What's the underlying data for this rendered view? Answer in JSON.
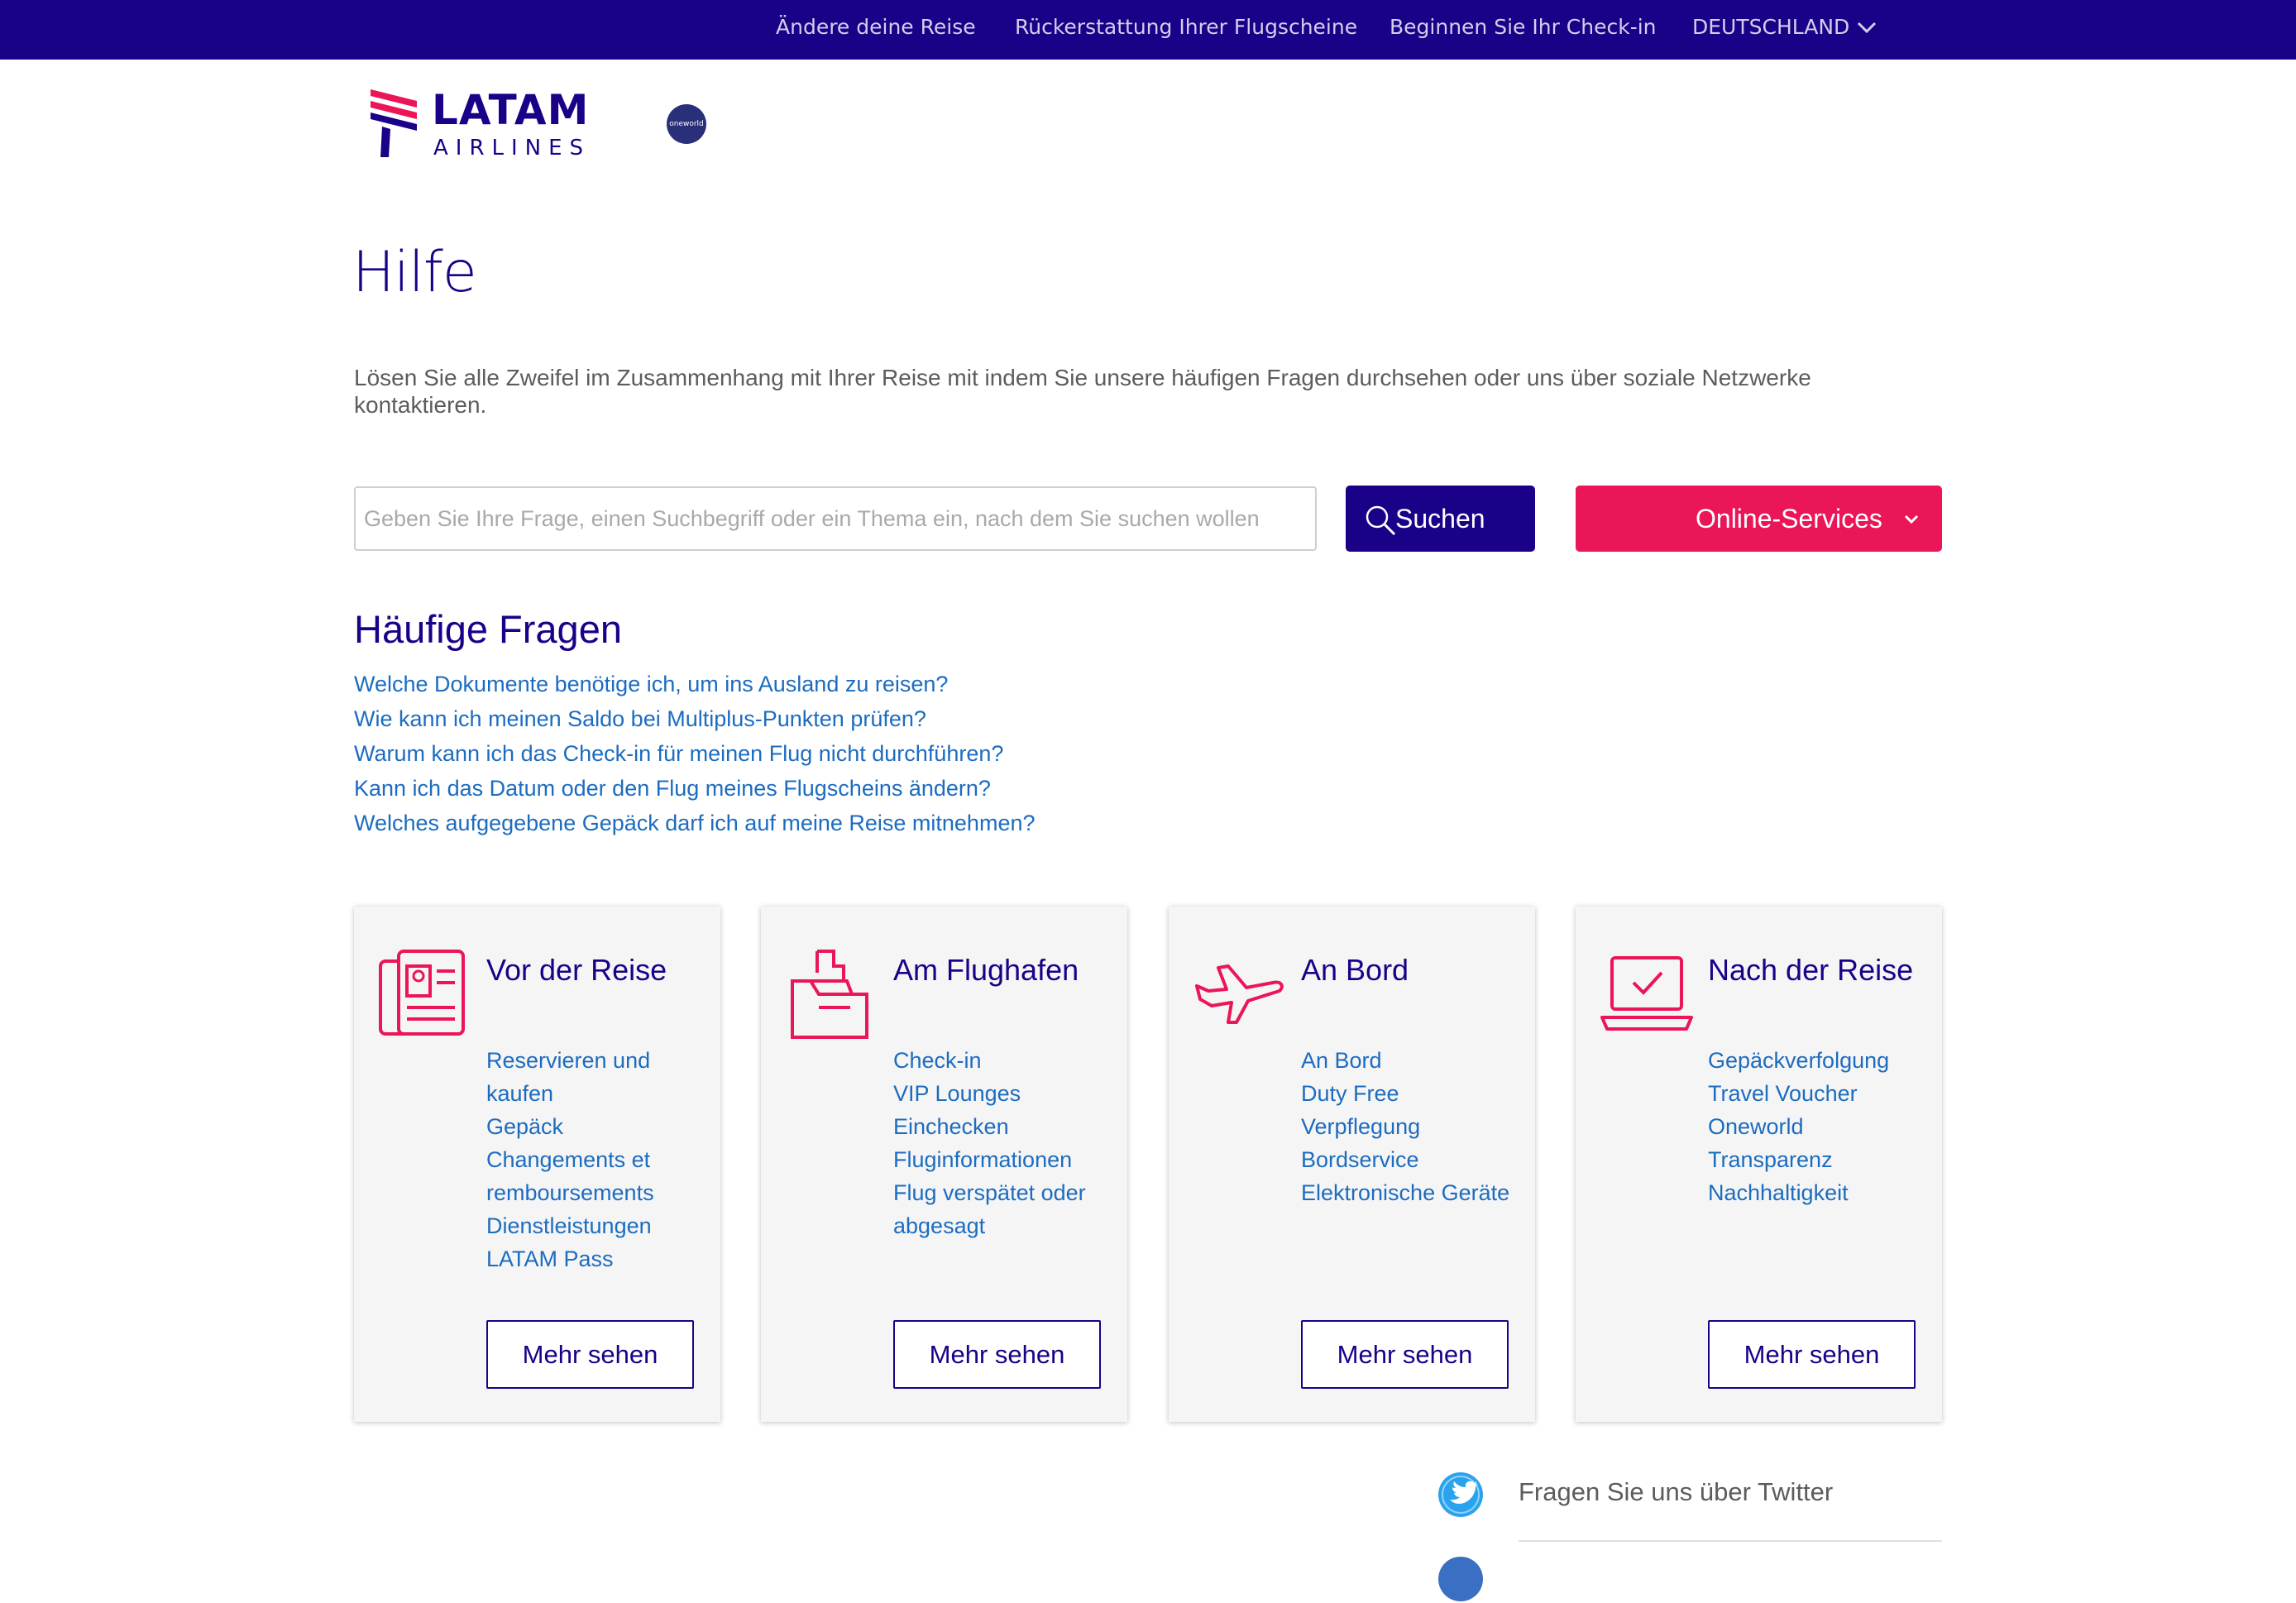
{
  "topbar": {
    "links": [
      "Ändere deine Reise",
      "Rückerstattung Ihrer Flugscheine",
      "Beginnen Sie Ihr Check-in"
    ],
    "country": "DEUTSCHLAND"
  },
  "brand": {
    "name": "LATAM",
    "subname": "AIRLINES",
    "alliance": "oneworld",
    "colors": {
      "navy": "#1b0088",
      "pink": "#ea1657",
      "link": "#1c6cc0"
    }
  },
  "page": {
    "title": "Hilfe",
    "intro": "Lösen Sie alle Zweifel im Zusammenhang mit Ihrer Reise mit indem Sie unsere häufigen Fragen durchsehen oder uns über soziale Netzwerke kontaktieren."
  },
  "search": {
    "placeholder": "Geben Sie Ihre Frage, einen Suchbegriff oder ein Thema ein, nach dem Sie suchen wollen",
    "value": "",
    "button": "Suchen",
    "online_services": "Online-Services"
  },
  "faq": {
    "heading": "Häufige Fragen",
    "items": [
      "Welche Dokumente benötige ich, um ins Ausland zu reisen?",
      "Wie kann ich meinen Saldo bei Multiplus-Punkten prüfen?",
      "Warum kann ich das Check-in für meinen Flug nicht durchführen?",
      "Kann ich das Datum oder den Flug meines Flugscheins ändern?",
      "Welches aufgegebene Gepäck darf ich auf meine Reise mitnehmen?"
    ]
  },
  "cards": [
    {
      "title": "Vor der Reise",
      "icon": "passport-icon",
      "links": [
        "Reservieren und kaufen",
        "Gepäck",
        "Changements et remboursements",
        "Dienstleistungen",
        "LATAM Pass"
      ],
      "button": "Mehr sehen"
    },
    {
      "title": "Am Flughafen",
      "icon": "kiosk-icon",
      "links": [
        "Check-in",
        "VIP Lounges",
        "Einchecken",
        "Fluginformationen",
        "Flug verspätet oder abgesagt"
      ],
      "button": "Mehr sehen"
    },
    {
      "title": "An Bord",
      "icon": "airplane-icon",
      "links": [
        "An Bord",
        "Duty Free",
        "Verpflegung",
        "Bordservice",
        "Elektronische Geräte"
      ],
      "button": "Mehr sehen"
    },
    {
      "title": "Nach der Reise",
      "icon": "laptop-check-icon",
      "links": [
        "Gepäckverfolgung",
        "Travel Voucher",
        "Oneworld",
        "Transparenz",
        "Nachhaltigkeit"
      ],
      "button": "Mehr sehen"
    }
  ],
  "social": {
    "twitter": "Fragen Sie uns über Twitter"
  }
}
